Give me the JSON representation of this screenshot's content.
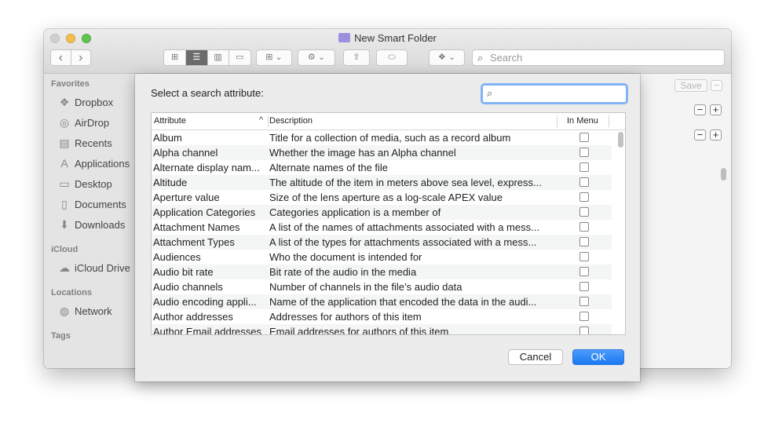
{
  "window": {
    "title": "New Smart Folder",
    "search_placeholder": "Search",
    "save_label": "Save",
    "minus_symbol": "−",
    "plus_symbol": "+"
  },
  "toolbar": {
    "back": "‹",
    "forward": "›",
    "view_icons": "⊞",
    "view_list": "☰",
    "view_columns": "▥",
    "view_gallery": "▭",
    "group": "⊞ ⌄",
    "action": "⚙ ⌄",
    "share": "⇧",
    "tag": "⬭",
    "dropbox": "❖ ⌄"
  },
  "sidebar": {
    "sections": [
      {
        "title": "Favorites"
      },
      {
        "title": "iCloud"
      },
      {
        "title": "Locations"
      },
      {
        "title": "Tags"
      }
    ],
    "items": [
      {
        "label": "Dropbox",
        "icon": "❖"
      },
      {
        "label": "AirDrop",
        "icon": "◎"
      },
      {
        "label": "Recents",
        "icon": "▤"
      },
      {
        "label": "Applications",
        "icon": "A"
      },
      {
        "label": "Desktop",
        "icon": "▭"
      },
      {
        "label": "Documents",
        "icon": "▯"
      },
      {
        "label": "Downloads",
        "icon": "⬇"
      },
      {
        "label": "iCloud Drive",
        "icon": "☁"
      },
      {
        "label": "Network",
        "icon": "◍"
      }
    ]
  },
  "sheet": {
    "prompt": "Select a search attribute:",
    "search_icon": "⌕",
    "columns": {
      "attribute": "Attribute",
      "sort_indicator": "^",
      "description": "Description",
      "in_menu": "In Menu"
    },
    "rows": [
      {
        "attribute": "Album",
        "description": "Title for a collection of media, such as a record album"
      },
      {
        "attribute": "Alpha channel",
        "description": "Whether the image has an Alpha channel"
      },
      {
        "attribute": "Alternate display nam...",
        "description": "Alternate names of the file"
      },
      {
        "attribute": "Altitude",
        "description": "The altitude of the item in meters above sea level, express..."
      },
      {
        "attribute": "Aperture value",
        "description": "Size of the lens aperture as a log-scale APEX value"
      },
      {
        "attribute": "Application Categories",
        "description": "Categories application is a member of"
      },
      {
        "attribute": "Attachment Names",
        "description": "A list of the names of attachments associated with a mess..."
      },
      {
        "attribute": "Attachment Types",
        "description": "A list of the types for attachments associated with a mess..."
      },
      {
        "attribute": "Audiences",
        "description": "Who the document is intended for"
      },
      {
        "attribute": "Audio bit rate",
        "description": "Bit rate of the audio in the media"
      },
      {
        "attribute": "Audio channels",
        "description": "Number of channels in the file’s audio data"
      },
      {
        "attribute": "Audio encoding appli...",
        "description": "Name of the application that encoded the data in the audi..."
      },
      {
        "attribute": "Author addresses",
        "description": "Addresses for authors of this item"
      },
      {
        "attribute": "Author Email addresses",
        "description": "Email addresses for authors of this item"
      }
    ],
    "cancel_label": "Cancel",
    "ok_label": "OK"
  }
}
